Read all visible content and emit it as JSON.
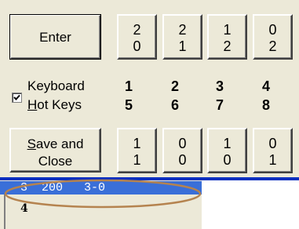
{
  "buttons": {
    "enter_label": "Enter",
    "save_line1": "Save and",
    "save_line2": "Close"
  },
  "digit_buttons_row1": [
    {
      "top": "2",
      "bottom": "0"
    },
    {
      "top": "2",
      "bottom": "1"
    },
    {
      "top": "1",
      "bottom": "2"
    },
    {
      "top": "0",
      "bottom": "2"
    }
  ],
  "digit_buttons_row3": [
    {
      "top": "1",
      "bottom": "1"
    },
    {
      "top": "0",
      "bottom": "0"
    },
    {
      "top": "1",
      "bottom": "0"
    },
    {
      "top": "0",
      "bottom": "1"
    }
  ],
  "hotkeys": {
    "checked": true,
    "label_line1": "Keyboard",
    "label_line2": "Hot Keys",
    "row1": [
      "1",
      "2",
      "3",
      "4"
    ],
    "row2": [
      "5",
      "6",
      "7",
      "8"
    ]
  },
  "list": {
    "selected_row": "3  200   3-0",
    "row2": "4"
  },
  "colors": {
    "panel": "#ece9d8",
    "selection": "#3a6fd8",
    "highlight_oval": "#b5834f"
  }
}
